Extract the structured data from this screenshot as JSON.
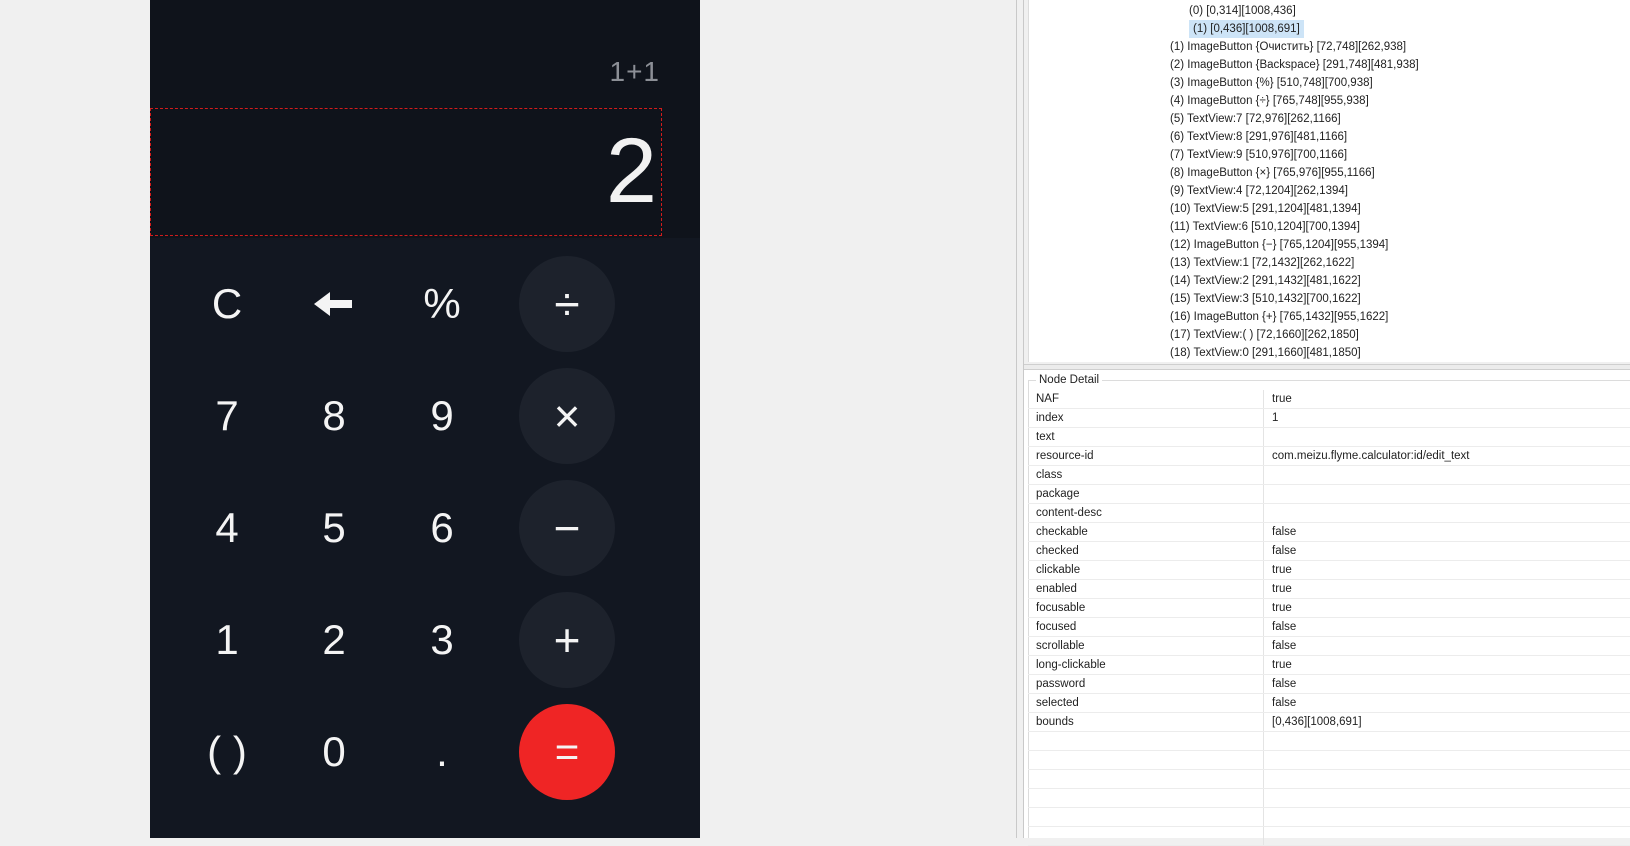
{
  "calculator": {
    "expression": "1+1",
    "result": "2",
    "keys": [
      {
        "label": "C"
      },
      {
        "label": "",
        "icon": "backspace-arrow-icon"
      },
      {
        "label": "%"
      },
      {
        "label": "÷"
      },
      {
        "label": "7"
      },
      {
        "label": "8"
      },
      {
        "label": "9"
      },
      {
        "label": "×"
      },
      {
        "label": "4"
      },
      {
        "label": "5"
      },
      {
        "label": "6"
      },
      {
        "label": "−"
      },
      {
        "label": "1"
      },
      {
        "label": "2"
      },
      {
        "label": "3"
      },
      {
        "label": "+"
      },
      {
        "label": "( )"
      },
      {
        "label": "0"
      },
      {
        "label": "."
      },
      {
        "label": "="
      }
    ],
    "colors": {
      "background": "#0f131b",
      "operator_key": "#1d222c",
      "equals_key": "#ef2525"
    }
  },
  "hierarchy": {
    "nodes": [
      "(0)  [0,314][1008,436]",
      "(1)  [0,436][1008,691]",
      "(1) ImageButton {Очистить} [72,748][262,938]",
      "(2) ImageButton {Backspace} [291,748][481,938]",
      "(3) ImageButton {%} [510,748][700,938]",
      "(4) ImageButton {÷} [765,748][955,938]",
      "(5) TextView:7 [72,976][262,1166]",
      "(6) TextView:8 [291,976][481,1166]",
      "(7) TextView:9 [510,976][700,1166]",
      "(8) ImageButton {×} [765,976][955,1166]",
      "(9) TextView:4 [72,1204][262,1394]",
      "(10) TextView:5 [291,1204][481,1394]",
      "(11) TextView:6 [510,1204][700,1394]",
      "(12) ImageButton {−} [765,1204][955,1394]",
      "(13) TextView:1 [72,1432][262,1622]",
      "(14) TextView:2 [291,1432][481,1622]",
      "(15) TextView:3 [510,1432][700,1622]",
      "(16) ImageButton {+} [765,1432][955,1622]",
      "(17) TextView:( ) [72,1660][262,1850]",
      "(18) TextView:0 [291,1660][481,1850]"
    ],
    "selected_index": 1
  },
  "node_detail": {
    "title": "Node Detail",
    "rows": [
      {
        "key": "NAF",
        "value": "true"
      },
      {
        "key": "index",
        "value": "1"
      },
      {
        "key": "text",
        "value": ""
      },
      {
        "key": "resource-id",
        "value": "com.meizu.flyme.calculator:id/edit_text"
      },
      {
        "key": "class",
        "value": ""
      },
      {
        "key": "package",
        "value": ""
      },
      {
        "key": "content-desc",
        "value": ""
      },
      {
        "key": "checkable",
        "value": "false"
      },
      {
        "key": "checked",
        "value": "false"
      },
      {
        "key": "clickable",
        "value": "true"
      },
      {
        "key": "enabled",
        "value": "true"
      },
      {
        "key": "focusable",
        "value": "true"
      },
      {
        "key": "focused",
        "value": "false"
      },
      {
        "key": "scrollable",
        "value": "false"
      },
      {
        "key": "long-clickable",
        "value": "true"
      },
      {
        "key": "password",
        "value": "false"
      },
      {
        "key": "selected",
        "value": "false"
      },
      {
        "key": "bounds",
        "value": "[0,436][1008,691]"
      },
      {
        "key": "",
        "value": ""
      },
      {
        "key": "",
        "value": ""
      },
      {
        "key": "",
        "value": ""
      },
      {
        "key": "",
        "value": ""
      },
      {
        "key": "",
        "value": ""
      },
      {
        "key": "",
        "value": ""
      }
    ]
  }
}
